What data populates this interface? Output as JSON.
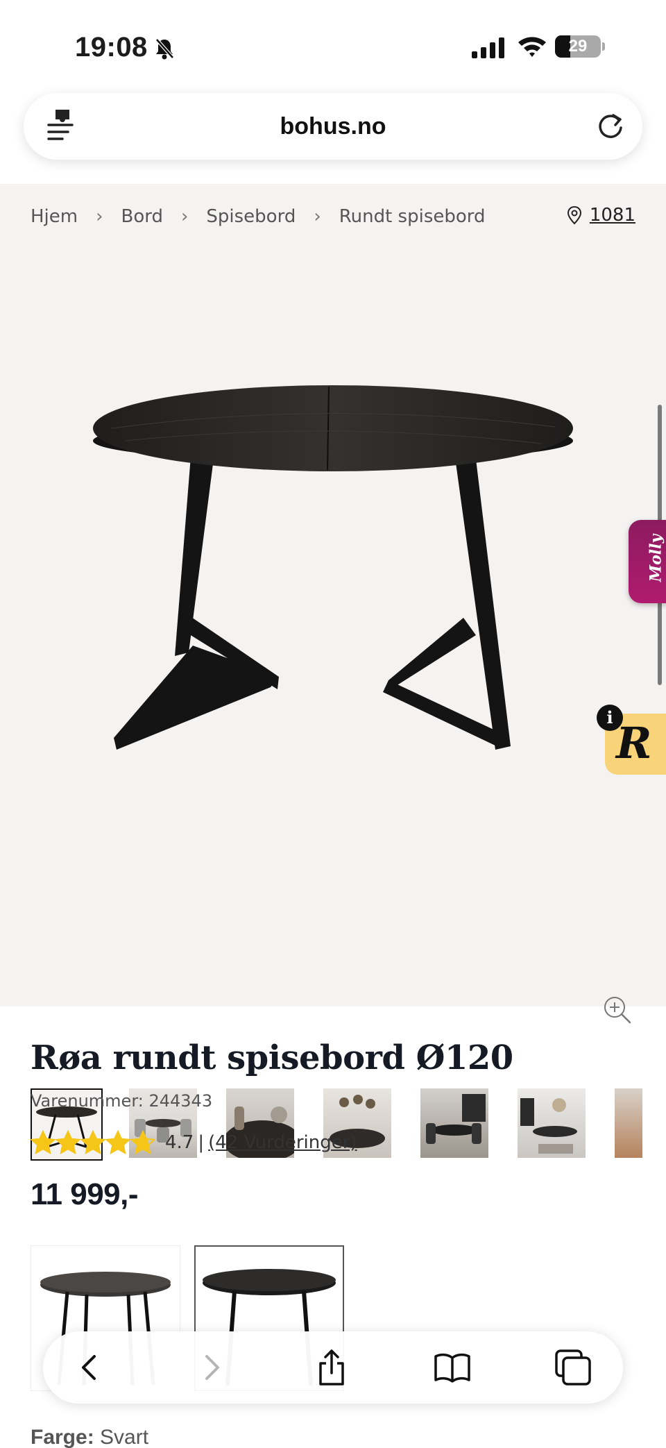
{
  "status_bar": {
    "time": "19:08",
    "battery": "29"
  },
  "browser": {
    "url": "bohus.no"
  },
  "breadcrumb": [
    {
      "label": "Hjem"
    },
    {
      "label": "Bord"
    },
    {
      "label": "Spisebord"
    },
    {
      "label": "Rundt spisebord"
    }
  ],
  "store": {
    "number": "1081"
  },
  "widgets": {
    "molly_label": "Molly",
    "r_badge_label": "R",
    "info_label": "i"
  },
  "gallery": {
    "thumbnail_count": 7,
    "active_index": 0
  },
  "product": {
    "title": "Røa rundt spisebord Ø120",
    "sku_label": "Varenummer: 244343",
    "rating_value": "4.7",
    "rating_fraction": 0.94,
    "rating_separator": "|",
    "reviews_label": "(42 Vurderinger)",
    "price": "11 999,-",
    "color_label": "Farge:",
    "color_value": "Svart"
  },
  "colors": {
    "star": "#f5c518",
    "gallery_bg": "#f5f3f2",
    "molly": "#a11b68",
    "r_badge": "#f8d37a"
  },
  "icons": [
    "bell-slash-icon",
    "signal-icon",
    "wifi-icon",
    "battery-icon",
    "site-settings-icon",
    "reload-icon",
    "chevron-right-icon",
    "location-pin-icon",
    "zoom-in-icon",
    "star-icon",
    "back-icon",
    "forward-icon",
    "share-icon",
    "bookmarks-icon",
    "tabs-icon"
  ]
}
